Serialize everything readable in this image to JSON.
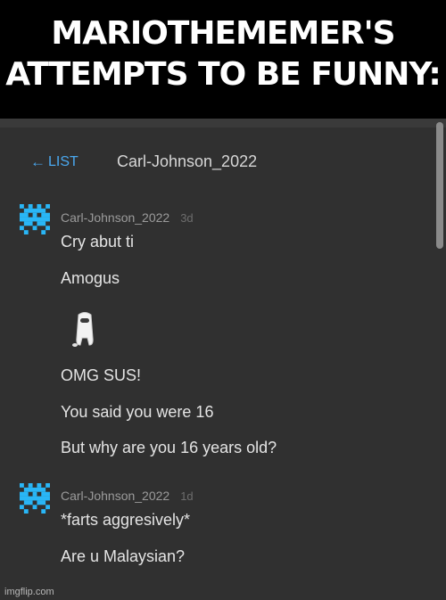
{
  "caption": {
    "line1": "MARIOTHEMEMER'S",
    "line2": "ATTEMPTS TO BE FUNNY:"
  },
  "header": {
    "back_label": "LIST",
    "thread_title": "Carl-Johnson_2022"
  },
  "messages": [
    {
      "username": "Carl-Johnson_2022",
      "time": "3d",
      "lines": [
        "Cry abut ti",
        "Amogus",
        "OMG SUS!",
        "You said you were 16",
        "But why are you 16 years old?"
      ]
    },
    {
      "username": "Carl-Johnson_2022",
      "time": "1d",
      "lines": [
        "*farts aggresively*",
        "Are u Malaysian?"
      ]
    }
  ],
  "colors": {
    "accent": "#4aa8ef",
    "avatar": "#29b6f6",
    "background": "#303030"
  },
  "icons": {
    "back": "left-arrow-icon",
    "avatar": "pixel-avatar-icon",
    "sticker": "amogus-crewmate-icon"
  },
  "watermark": "imgflip.com"
}
